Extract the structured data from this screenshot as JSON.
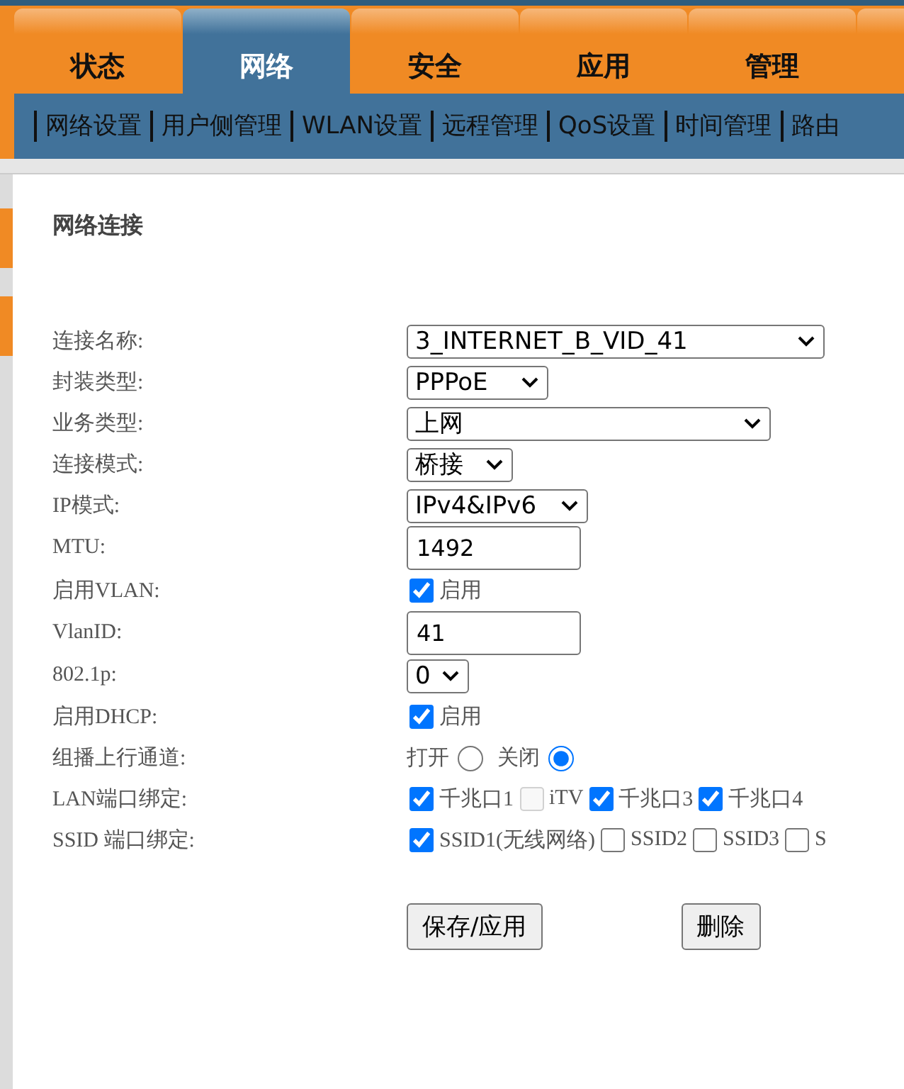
{
  "tabs": [
    {
      "label": "状态",
      "selected": false
    },
    {
      "label": "网络",
      "selected": true
    },
    {
      "label": "安全",
      "selected": false
    },
    {
      "label": "应用",
      "selected": false
    },
    {
      "label": "管理",
      "selected": false
    }
  ],
  "subnav": [
    "网络设置",
    "用户侧管理",
    "WLAN设置",
    "远程管理",
    "QoS设置",
    "时间管理",
    "路由"
  ],
  "section_title": "网络连接",
  "rows": [
    {
      "label": "连接名称:",
      "kind": "select",
      "value": "3_INTERNET_B_VID_41"
    },
    {
      "label": "封装类型:",
      "kind": "select",
      "value": "PPPoE"
    },
    {
      "label": "业务类型:",
      "kind": "select",
      "value": "上网"
    },
    {
      "label": "连接模式:",
      "kind": "select",
      "value": "桥接"
    },
    {
      "label": "IP模式:",
      "kind": "select",
      "value": "IPv4&IPv6"
    },
    {
      "label": "MTU:",
      "kind": "input",
      "value": "1492"
    },
    {
      "label": "启用VLAN:",
      "kind": "checkbox",
      "items": [
        {
          "label": "启用",
          "checked": true,
          "disabled": false
        }
      ]
    },
    {
      "label": "VlanID:",
      "kind": "input",
      "value": "41"
    },
    {
      "label": "802.1p:",
      "kind": "select",
      "value": "0"
    },
    {
      "label": "启用DHCP:",
      "kind": "checkbox",
      "items": [
        {
          "label": "启用",
          "checked": true,
          "disabled": false
        }
      ]
    },
    {
      "label": "组播上行通道:",
      "kind": "radio",
      "items": [
        {
          "label": "打开",
          "selected": false
        },
        {
          "label": "关闭",
          "selected": true
        }
      ]
    },
    {
      "label": "LAN端口绑定:",
      "kind": "checkbox",
      "items": [
        {
          "label": "千兆口1",
          "checked": true,
          "disabled": false
        },
        {
          "label": "iTV",
          "checked": false,
          "disabled": true
        },
        {
          "label": "千兆口3",
          "checked": true,
          "disabled": false
        },
        {
          "label": "千兆口4",
          "checked": true,
          "disabled": false
        }
      ]
    },
    {
      "label": "SSID 端口绑定:",
      "kind": "checkbox",
      "items": [
        {
          "label": "SSID1(无线网络)",
          "checked": true,
          "disabled": false
        },
        {
          "label": "SSID2",
          "checked": false,
          "disabled": false
        },
        {
          "label": "SSID3",
          "checked": false,
          "disabled": false
        },
        {
          "label": "S",
          "checked": false,
          "disabled": false
        }
      ]
    }
  ],
  "buttons": [
    "保存/应用",
    "删除"
  ]
}
